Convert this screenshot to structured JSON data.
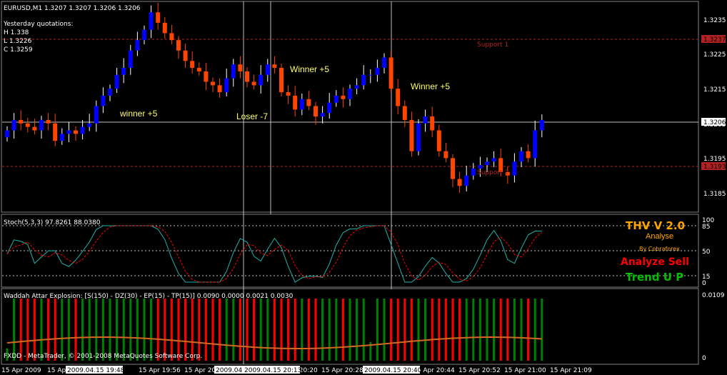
{
  "symbol_header": "EURUSD,M1  1.3207 1.3207 1.3206 1.3206",
  "yesterday": {
    "title": "Yesterday quotations:",
    "high": "H 1.338",
    "low": "L 1.3226",
    "close": "C 1.3259"
  },
  "annotations": {
    "winner_1": "winner +5",
    "loser": "Loser -7",
    "winner_2": "Winner +5",
    "winner_3": "Winner +5",
    "support_1": "Support 1",
    "support_2": "Support 2"
  },
  "price_axis": {
    "ticks": [
      "1.3235",
      "1.3225",
      "1.3215",
      "1.3205",
      "1.3195",
      "1.3185"
    ],
    "tick_values": [
      1.3235,
      1.3225,
      1.3215,
      1.3205,
      1.3195,
      1.3185
    ],
    "current_price": "1.3206",
    "support_1_price": "1.3237",
    "support_2_price": "1.3193"
  },
  "stoch": {
    "header": "Stoch(5,3,3) 97.8261 88.0380",
    "ticks": [
      "100",
      "85",
      "50",
      "15",
      "0"
    ],
    "tick_values": [
      100,
      85,
      50,
      15,
      0
    ],
    "main_color": "#20b2aa",
    "signal_color": "#ff0000"
  },
  "thv": {
    "title": "THV V 2.0",
    "subtitle": "Analyse",
    "credit": "By Cobraforex",
    "signal": "Analyze Sell",
    "trend": "Trend U P",
    "title_color": "#ffa500",
    "signal_color": "#ff0000",
    "trend_color": "#00c000"
  },
  "waddah": {
    "header": "Waddah Attar Explosion: [S(150) - DZ(30) - EP(15) - TP(15)] 0.0090 0.0000 0.0021 0.0030",
    "ticks": [
      "0.0109",
      "0"
    ],
    "copyright": "FXDD - MetaTrader, © 2001-2008 MetaQuotes Software Corp."
  },
  "time_axis": {
    "labels": [
      "15 Apr 2009",
      "15 Apr 19:48",
      "15 Apr 19:56",
      "15 Apr 20:04",
      "15 Apr 20:12",
      "15 Apr 20:20",
      "15 Apr 20:28",
      "15 Apr 20:36",
      "15 Apr 20:44",
      "15 Apr 20:52",
      "15 Apr 21:00",
      "15 Apr 21:09"
    ],
    "cursor_labels": [
      "2009.04.15 19:48",
      "2009.04.15 20:04",
      "2009.04.15 20:13",
      "2009.04.15 20:40"
    ]
  },
  "colors": {
    "bull": "#0000ff",
    "bear": "#ff4500",
    "support": "#b22222",
    "grid": "#c0c0c0",
    "waddah_up": "#008000",
    "waddah_down": "#ff0000",
    "waddah_line": "#d2691e"
  },
  "chart_data": {
    "type": "candlestick",
    "symbol": "EURUSD",
    "timeframe": "M1",
    "close_series": [
      1.3203,
      1.3206,
      1.3205,
      1.3204,
      1.3203,
      1.3206,
      1.3205,
      1.32,
      1.3202,
      1.3203,
      1.3202,
      1.3204,
      1.3205,
      1.321,
      1.3213,
      1.3215,
      1.3219,
      1.3221,
      1.3226,
      1.3229,
      1.3232,
      1.3237,
      1.3234,
      1.3231,
      1.3229,
      1.3226,
      1.3223,
      1.3221,
      1.322,
      1.3217,
      1.3216,
      1.3214,
      1.3218,
      1.3222,
      1.322,
      1.3217,
      1.3216,
      1.3219,
      1.3222,
      1.3221,
      1.3214,
      1.3213,
      1.3209,
      1.3212,
      1.321,
      1.3207,
      1.3208,
      1.3211,
      1.3213,
      1.3212,
      1.3215,
      1.3216,
      1.3219,
      1.3219,
      1.3221,
      1.3224,
      1.3215,
      1.321,
      1.3206,
      1.3197,
      1.3205,
      1.3207,
      1.3203,
      1.3197,
      1.3195,
      1.3189,
      1.3187,
      1.319,
      1.3192,
      1.3193,
      1.3194,
      1.3195,
      1.3191,
      1.319,
      1.3194,
      1.3197,
      1.3195,
      1.3203,
      1.3206
    ]
  }
}
